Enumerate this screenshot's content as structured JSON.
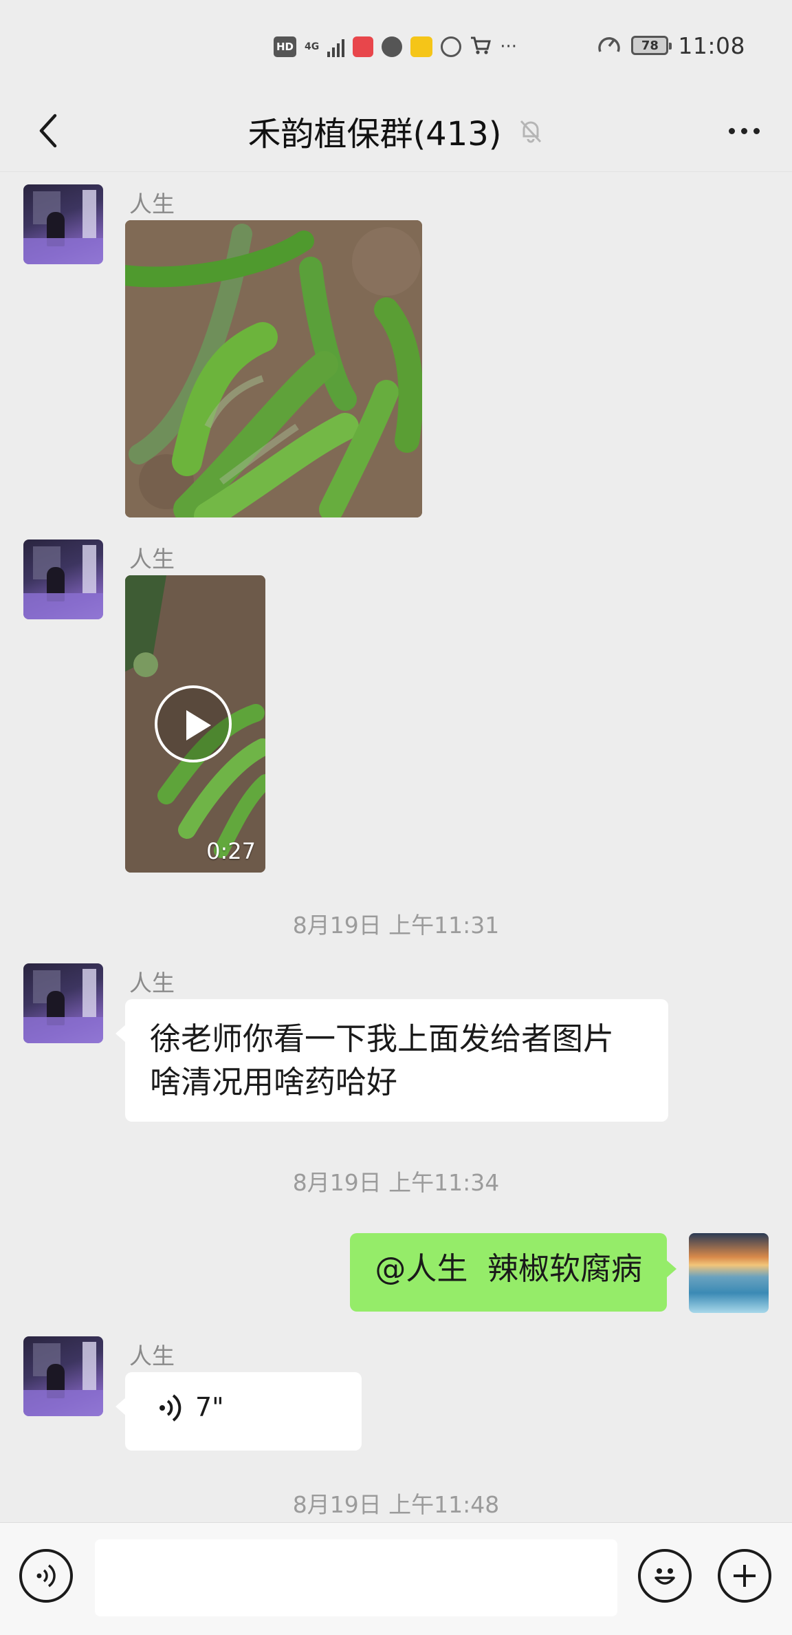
{
  "status_bar": {
    "hd_label": "HD",
    "network_label": "4G",
    "battery": "78",
    "time": "11:08",
    "more_label": "···"
  },
  "nav": {
    "title": "禾韵植保群(413)",
    "back_icon": "chevron-left-icon",
    "mute_icon": "bell-off-icon",
    "more_icon": "ellipsis-icon"
  },
  "messages": [
    {
      "type": "image",
      "sender": "人生"
    },
    {
      "type": "video",
      "sender": "人生",
      "duration": "0:27"
    },
    {
      "type": "timestamp",
      "text": "8月19日 上午11:31"
    },
    {
      "type": "text",
      "sender": "人生",
      "lines": [
        "徐老师你看一下我上面发给者图片",
        "啥清况用啥药哈好"
      ]
    },
    {
      "type": "timestamp",
      "text": "8月19日 上午11:34"
    },
    {
      "type": "text",
      "sender": "me",
      "text": "@人生  辣椒软腐病"
    },
    {
      "type": "voice",
      "sender": "人生",
      "duration": "7\""
    },
    {
      "type": "timestamp",
      "text": "8月19日 上午11:48"
    }
  ],
  "input_bar": {
    "voice_icon": "voice-mode-icon",
    "input_value": "",
    "emoji_icon": "emoji-icon",
    "plus_icon": "plus-icon"
  },
  "colors": {
    "background": "#ededed",
    "my_bubble": "#95ec69",
    "other_bubble": "#ffffff"
  }
}
